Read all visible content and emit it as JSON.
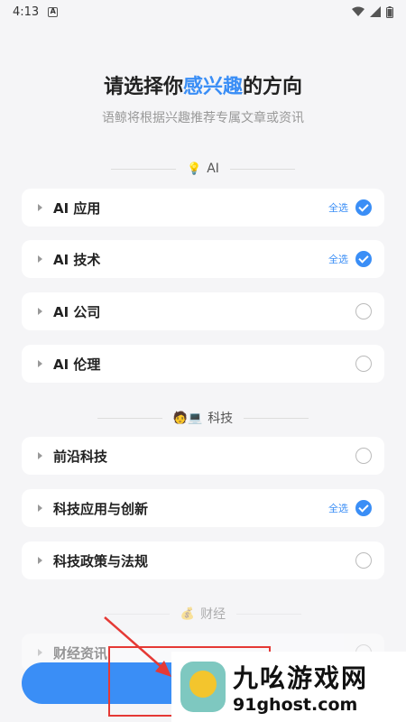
{
  "status_bar": {
    "time": "4:13",
    "notification_glyph": "A"
  },
  "header": {
    "title_prefix": "请选择你",
    "title_highlight": "感兴趣",
    "title_suffix": "的方向",
    "subtitle": "语鲸将根据兴趣推荐专属文章或资讯"
  },
  "sections": [
    {
      "emoji": "💡",
      "title": "AI",
      "items": [
        {
          "label": "AI 应用",
          "select_all": "全选",
          "checked": true
        },
        {
          "label": "AI 技术",
          "select_all": "全选",
          "checked": true
        },
        {
          "label": "AI 公司",
          "checked": false
        },
        {
          "label": "AI 伦理",
          "checked": false
        }
      ]
    },
    {
      "emoji": "🧑💻",
      "title": "科技",
      "items": [
        {
          "label": "前沿科技",
          "checked": false
        },
        {
          "label": "科技应用与创新",
          "select_all": "全选",
          "checked": true
        },
        {
          "label": "科技政策与法规",
          "checked": false
        }
      ]
    },
    {
      "emoji": "💰",
      "title": "财经",
      "items": [
        {
          "label": "财经资讯",
          "checked": false
        }
      ]
    }
  ],
  "watermark": {
    "name": "九吆游戏网",
    "url": "91ghost.com"
  },
  "colors": {
    "accent": "#3a8ef6",
    "annotation": "#e53935"
  }
}
